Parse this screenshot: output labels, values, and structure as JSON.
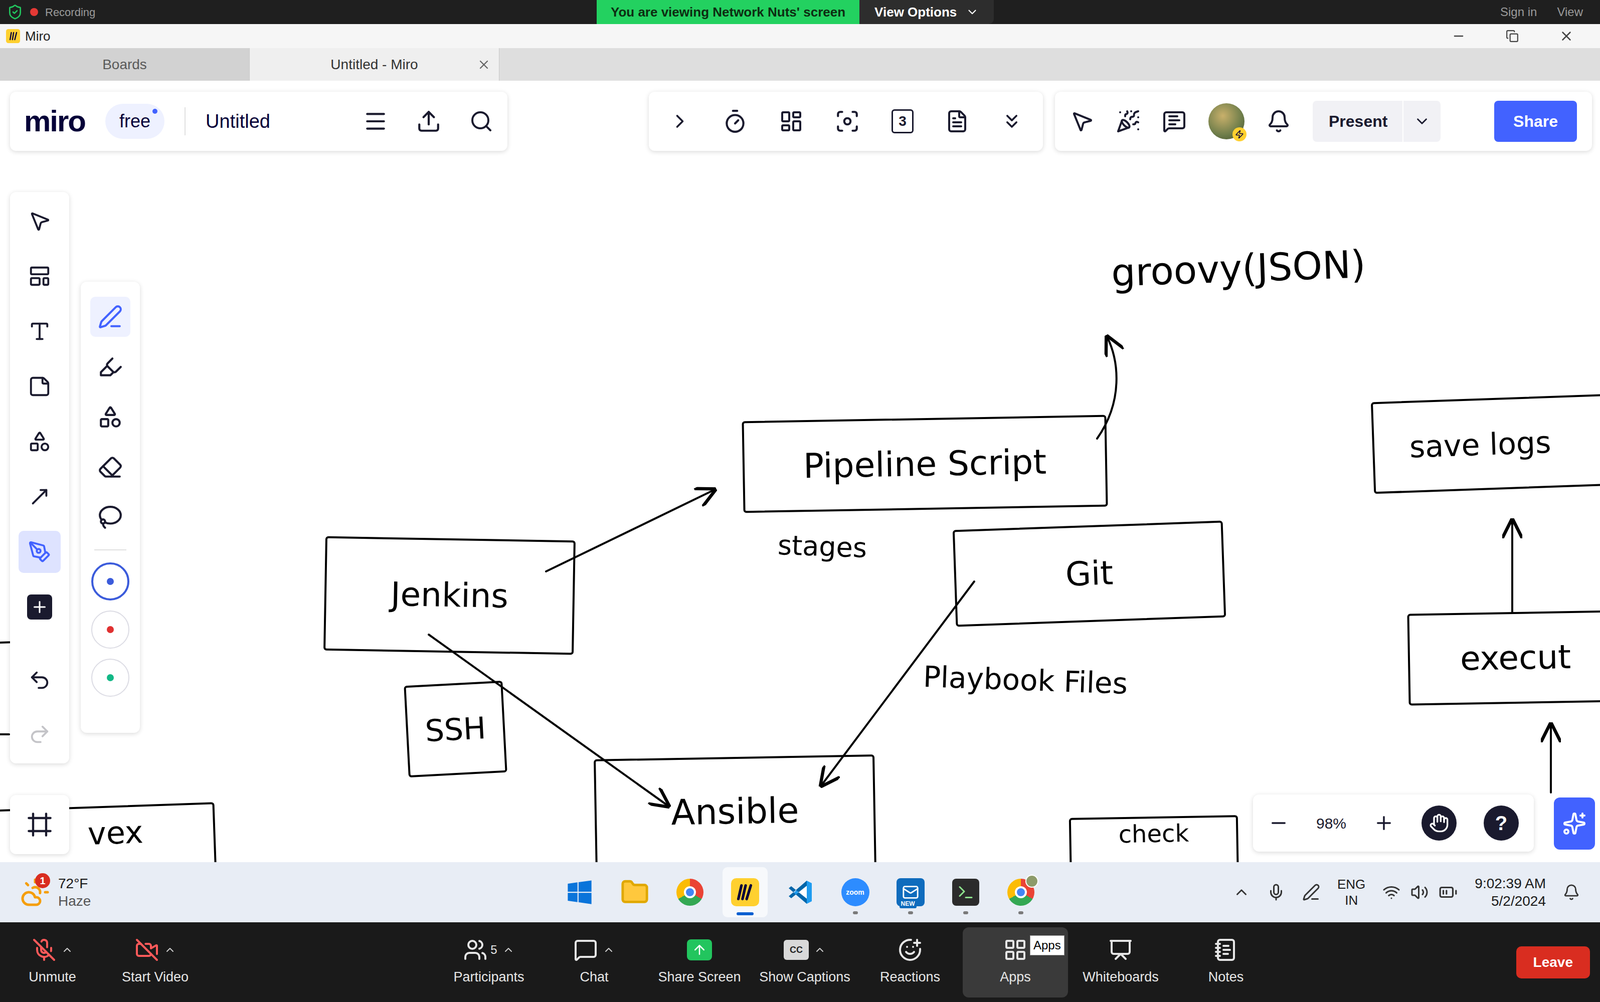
{
  "zoom_banner": {
    "recording": "Recording",
    "viewing": "You are viewing Network Nuts' screen",
    "view_options": "View Options",
    "sign_in": "Sign in",
    "view": "View"
  },
  "window": {
    "title": "Miro"
  },
  "tabs": [
    {
      "label": "Boards",
      "selected": false,
      "closable": false
    },
    {
      "label": "Untitled - Miro",
      "selected": true,
      "closable": true
    }
  ],
  "board_toolbar": {
    "logo": "miro",
    "plan": "free",
    "board_name": "Untitled"
  },
  "collab_toolbar": {
    "counter": "3"
  },
  "session_toolbar": {
    "present": "Present",
    "share": "Share"
  },
  "tools": [
    {
      "kind": "select",
      "selected": false
    },
    {
      "kind": "templates",
      "selected": false
    },
    {
      "kind": "text",
      "selected": false
    },
    {
      "kind": "sticky",
      "selected": false
    },
    {
      "kind": "shapes",
      "selected": false
    },
    {
      "kind": "line",
      "selected": false
    },
    {
      "kind": "pen",
      "selected": true
    },
    {
      "kind": "add",
      "selected": false
    }
  ],
  "pen_tools": [
    {
      "kind": "pen",
      "selected": true
    },
    {
      "kind": "highlighter",
      "selected": false
    },
    {
      "kind": "smart",
      "selected": false
    },
    {
      "kind": "eraser",
      "selected": false
    },
    {
      "kind": "lasso",
      "selected": false
    }
  ],
  "pen_colors": [
    {
      "color": "#3b5bdb",
      "selected": true
    },
    {
      "color": "#e03131",
      "selected": false
    },
    {
      "color": "#12b886",
      "selected": false
    }
  ],
  "diagram": {
    "nodes": [
      {
        "label": "groovy(JSON)",
        "boxed": false
      },
      {
        "label": "Pipeline Script",
        "boxed": true
      },
      {
        "label": "stages",
        "boxed": false
      },
      {
        "label": "Jenkins",
        "boxed": true
      },
      {
        "label": "Git",
        "boxed": true
      },
      {
        "label": "Playbook Files",
        "boxed": false
      },
      {
        "label": "SSH",
        "boxed": true
      },
      {
        "label": "Ansible",
        "boxed": true
      },
      {
        "label": "save logs",
        "boxed": true
      },
      {
        "label": "execut",
        "boxed": true
      },
      {
        "label": "vex",
        "boxed": true
      },
      {
        "label": "check",
        "boxed": true
      }
    ]
  },
  "zoom": {
    "level": "98%",
    "help": "?"
  },
  "taskbar": {
    "weather": {
      "temp": "72°F",
      "condition": "Haze",
      "badge": "1"
    },
    "apps": [
      {
        "kind": "start",
        "selected": false,
        "running": false
      },
      {
        "kind": "explorer",
        "selected": false,
        "running": false
      },
      {
        "kind": "chrome",
        "selected": false,
        "running": false
      },
      {
        "kind": "miro",
        "selected": true,
        "running": true
      },
      {
        "kind": "vscode",
        "selected": false,
        "running": false
      },
      {
        "kind": "zoom",
        "label": "zoom",
        "selected": false,
        "running": true
      },
      {
        "kind": "outlook",
        "label": "NEW",
        "selected": false,
        "running": true
      },
      {
        "kind": "terminal",
        "selected": false,
        "running": true
      },
      {
        "kind": "chrome-profile",
        "selected": false,
        "running": true
      }
    ],
    "language": "ENG",
    "region": "IN",
    "time": "9:02:39 AM",
    "date": "5/2/2024"
  },
  "meeting": {
    "controls": [
      {
        "kind": "audio",
        "label": "Unmute",
        "off": true,
        "menu": true,
        "selected": false
      },
      {
        "kind": "video",
        "label": "Start Video",
        "off": true,
        "menu": true,
        "selected": false
      },
      {
        "kind": "participants",
        "label": "Participants",
        "count": "5",
        "menu": true,
        "selected": false
      },
      {
        "kind": "chat",
        "label": "Chat",
        "menu": true,
        "selected": false
      },
      {
        "kind": "share",
        "label": "Share Screen",
        "menu": false,
        "selected": false
      },
      {
        "kind": "captions",
        "label": "Show Captions",
        "badge": "CC",
        "menu": true,
        "selected": false
      },
      {
        "kind": "reactions",
        "label": "Reactions",
        "menu": false,
        "selected": false
      },
      {
        "kind": "apps",
        "label": "Apps",
        "tooltip": "Apps",
        "menu": false,
        "selected": true
      },
      {
        "kind": "whiteboards",
        "label": "Whiteboards",
        "menu": false,
        "selected": false
      },
      {
        "kind": "notes",
        "label": "Notes",
        "menu": false,
        "selected": false
      }
    ],
    "leave": "Leave"
  }
}
